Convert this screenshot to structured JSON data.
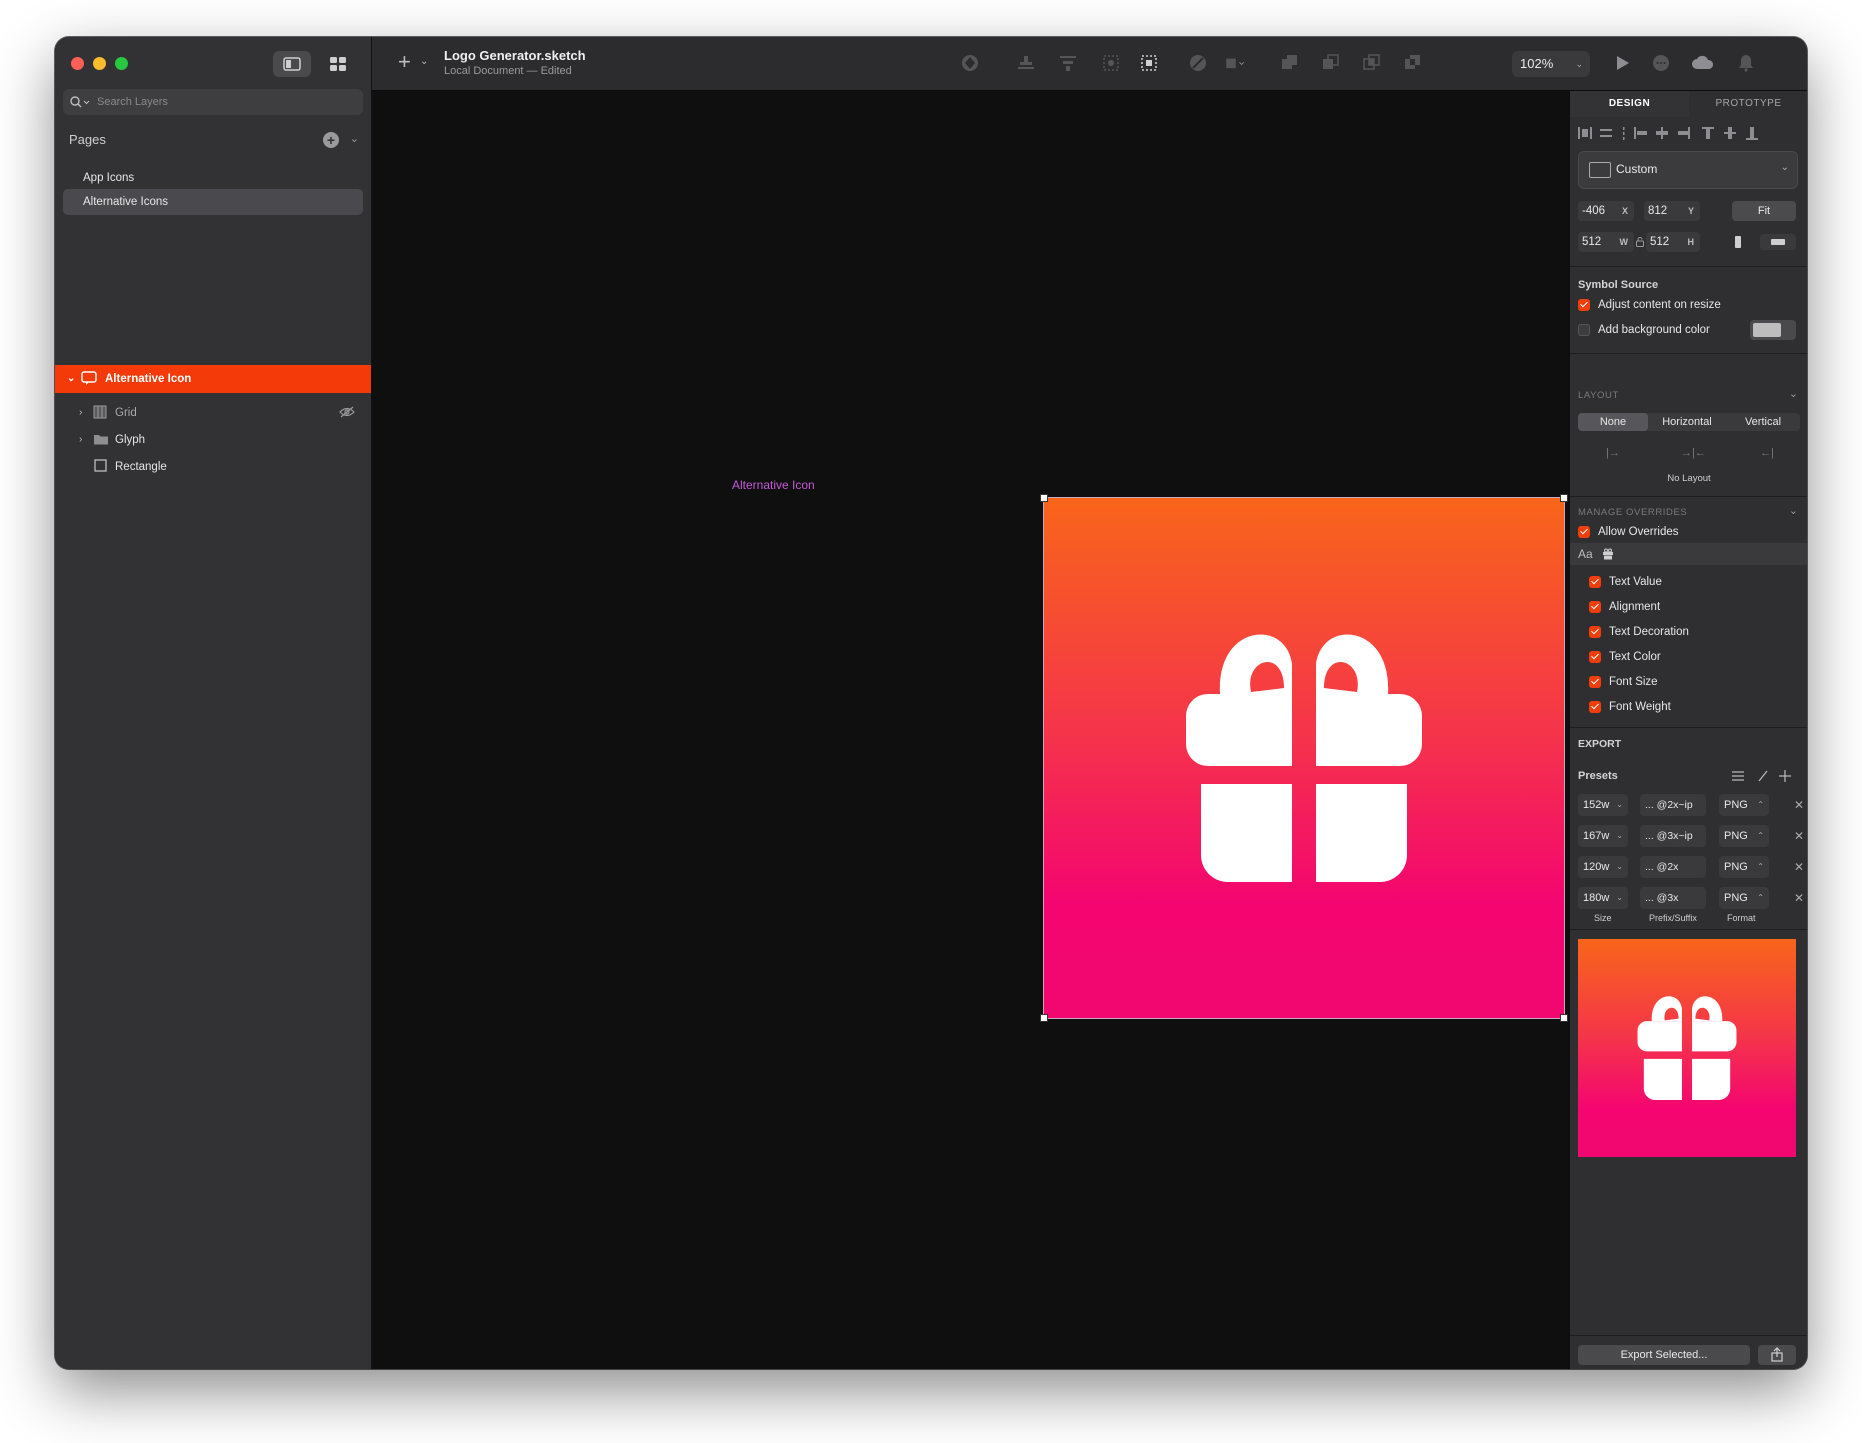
{
  "window": {
    "title": "Logo Generator.sketch",
    "subtitle": "Local Document — Edited",
    "zoom": "102%"
  },
  "sidebar": {
    "search_placeholder": "Search Layers",
    "pages_label": "Pages",
    "pages": [
      {
        "label": "App Icons",
        "selected": false
      },
      {
        "label": "Alternative Icons",
        "selected": true
      }
    ],
    "layers": [
      {
        "label": "Alternative Icon",
        "selected": true,
        "icon": "symbol-icon"
      },
      {
        "label": "Grid",
        "selected": false,
        "icon": "grid-icon",
        "hidden": true
      },
      {
        "label": "Glyph",
        "selected": false,
        "icon": "folder-icon"
      },
      {
        "label": "Rectangle",
        "selected": false,
        "icon": "rectangle-icon"
      }
    ]
  },
  "canvas": {
    "artboard_label": "Alternative Icon",
    "gradient_top": "#f8651a",
    "gradient_bottom": "#f1076f"
  },
  "inspector": {
    "tabs": [
      "DESIGN",
      "PROTOTYPE"
    ],
    "preset": "Custom",
    "x": "-406",
    "x_label": "X",
    "y": "812",
    "y_label": "Y",
    "w": "512",
    "w_label": "W",
    "h": "512",
    "h_label": "H",
    "fit_label": "Fit",
    "symbol_source": "Symbol Source",
    "adjust_content": "Adjust content on resize",
    "add_background": "Add background color",
    "layout_title": "LAYOUT",
    "layout_options": [
      "None",
      "Horizontal",
      "Vertical"
    ],
    "layout_selected": "None",
    "no_layout": "No Layout",
    "manage_overrides": "MANAGE OVERRIDES",
    "allow_overrides": "Allow Overrides",
    "override_text_icon": "Aa",
    "overrides": [
      "Text Value",
      "Alignment",
      "Text Decoration",
      "Text Color",
      "Font Size",
      "Font Weight"
    ],
    "export_title": "EXPORT",
    "presets_label": "Presets",
    "export_rows": [
      {
        "size": "152w",
        "suffix": "... @2x~ip",
        "format": "PNG"
      },
      {
        "size": "167w",
        "suffix": "... @3x~ip",
        "format": "PNG"
      },
      {
        "size": "120w",
        "suffix": "... @2x",
        "format": "PNG"
      },
      {
        "size": "180w",
        "suffix": "... @3x",
        "format": "PNG"
      }
    ],
    "col_size": "Size",
    "col_prefix": "Prefix/Suffix",
    "col_format": "Format",
    "export_button": "Export Selected..."
  }
}
